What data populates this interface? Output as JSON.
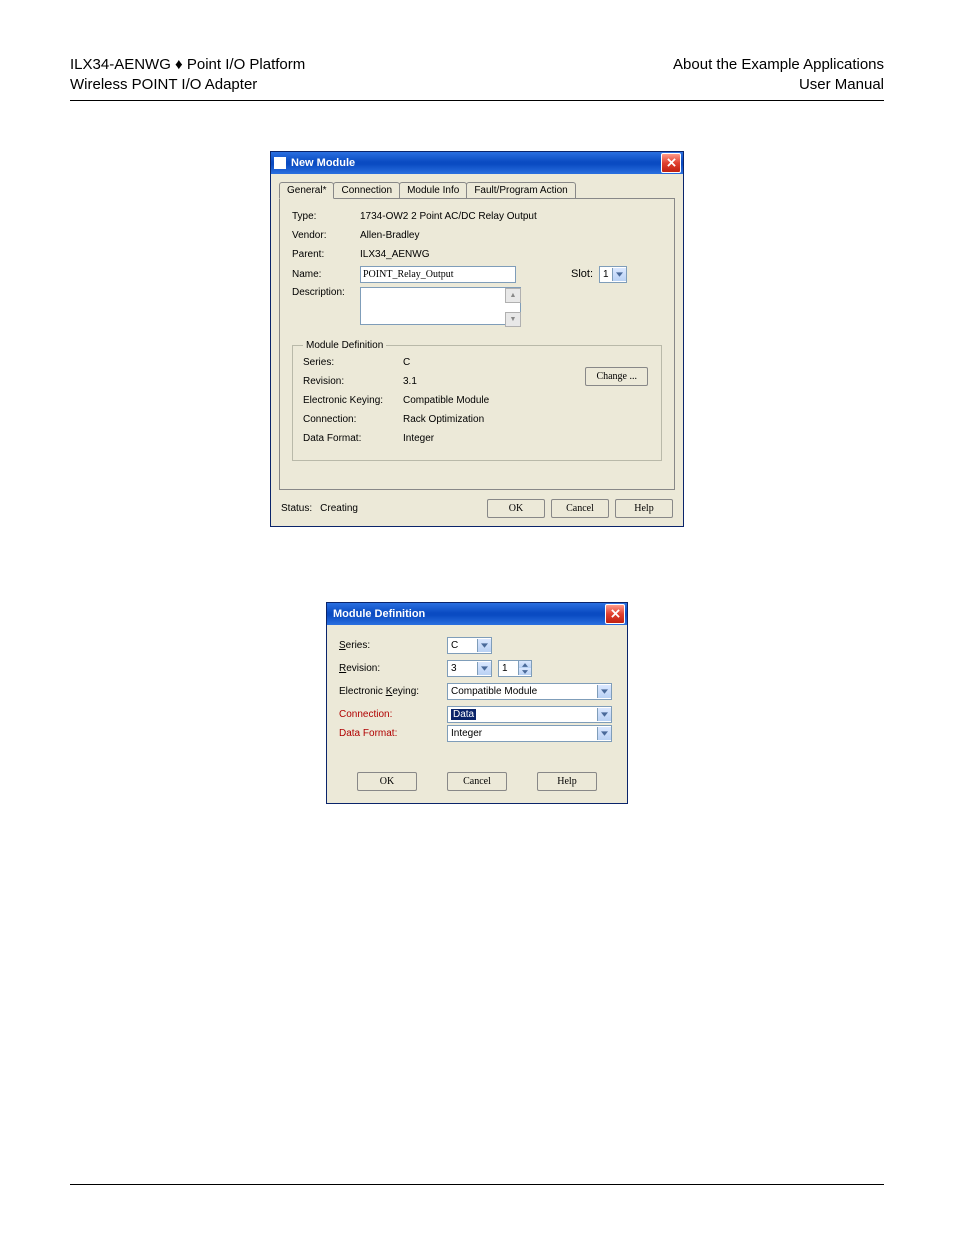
{
  "header": {
    "left1a": "ILX34-AENWG",
    "left1b": " Point I/O Platform",
    "left2": "Wireless POINT I/O Adapter",
    "right1": "About the Example Applications",
    "right2": "User Manual"
  },
  "dlg1": {
    "title": "New Module",
    "tabs": {
      "general": "General*",
      "connection": "Connection",
      "moduleinfo": "Module Info",
      "fault": "Fault/Program Action"
    },
    "labels": {
      "type": "Type:",
      "vendor": "Vendor:",
      "parent": "Parent:",
      "name": "Name:",
      "description": "Description:",
      "slot": "Slot:",
      "status": "Status:"
    },
    "values": {
      "type": "1734-OW2 2 Point AC/DC Relay Output",
      "vendor": "Allen-Bradley",
      "parent": "ILX34_AENWG",
      "name": "POINT_Relay_Output",
      "slot": "1",
      "status": "Creating"
    },
    "moddef": {
      "legend": "Module Definition",
      "series_l": "Series:",
      "series_v": "C",
      "rev_l": "Revision:",
      "rev_v": "3.1",
      "ek_l": "Electronic Keying:",
      "ek_v": "Compatible Module",
      "conn_l": "Connection:",
      "conn_v": "Rack Optimization",
      "df_l": "Data Format:",
      "df_v": "Integer",
      "change": "Change ..."
    },
    "buttons": {
      "ok": "OK",
      "cancel": "Cancel",
      "help": "Help"
    }
  },
  "dlg2": {
    "title": "Module Definition",
    "labels": {
      "series": "Series:",
      "revision": "Revision:",
      "ek": "Electronic Keying:",
      "connection": "Connection:",
      "dataformat": "Data Format:"
    },
    "values": {
      "series": "C",
      "rev_major": "3",
      "rev_minor": "1",
      "ek": "Compatible Module",
      "connection": "Data",
      "dataformat": "Integer"
    },
    "buttons": {
      "ok": "OK",
      "cancel": "Cancel",
      "help": "Help"
    }
  }
}
